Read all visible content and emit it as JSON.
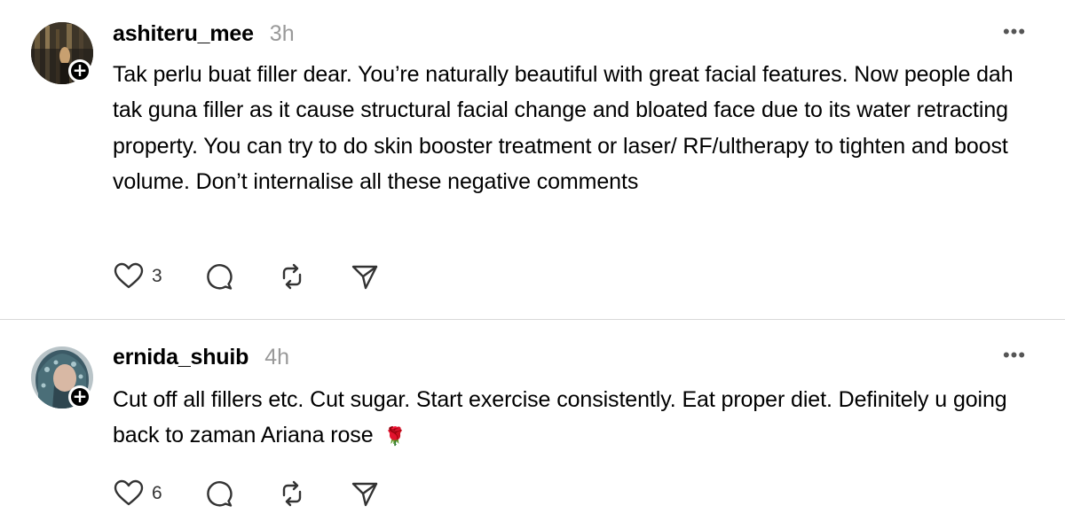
{
  "posts": [
    {
      "username": "ashiteru_mee",
      "timestamp": "3h",
      "text": "Tak perlu buat filler dear. You’re naturally beautiful with great facial features. Now people dah tak guna filler as it cause structural facial change and bloated face due to its water retracting property. You can try to do skin booster treatment or laser/ RF/ultherapy to tighten and boost volume. Don’t internalise all these negative comments",
      "emoji": "",
      "like_count": "3",
      "more_label": "•••",
      "follow_label": "+",
      "icons": [
        "avatar",
        "plus-icon",
        "heart-icon",
        "comment-icon",
        "repost-icon",
        "share-icon",
        "more-icon"
      ]
    },
    {
      "username": "ernida_shuib",
      "timestamp": "4h",
      "text": "Cut off all fillers etc. Cut sugar. Start exercise consistently. Eat proper diet. Definitely u going back to zaman Ariana rose",
      "emoji": "🌹",
      "like_count": "6",
      "more_label": "•••",
      "follow_label": "+",
      "icons": [
        "avatar",
        "plus-icon",
        "heart-icon",
        "comment-icon",
        "repost-icon",
        "share-icon",
        "more-icon"
      ]
    }
  ],
  "colors": {
    "text": "#000000",
    "timestamp": "#999999",
    "divider": "#d9d9d9",
    "icon": "#333333"
  }
}
